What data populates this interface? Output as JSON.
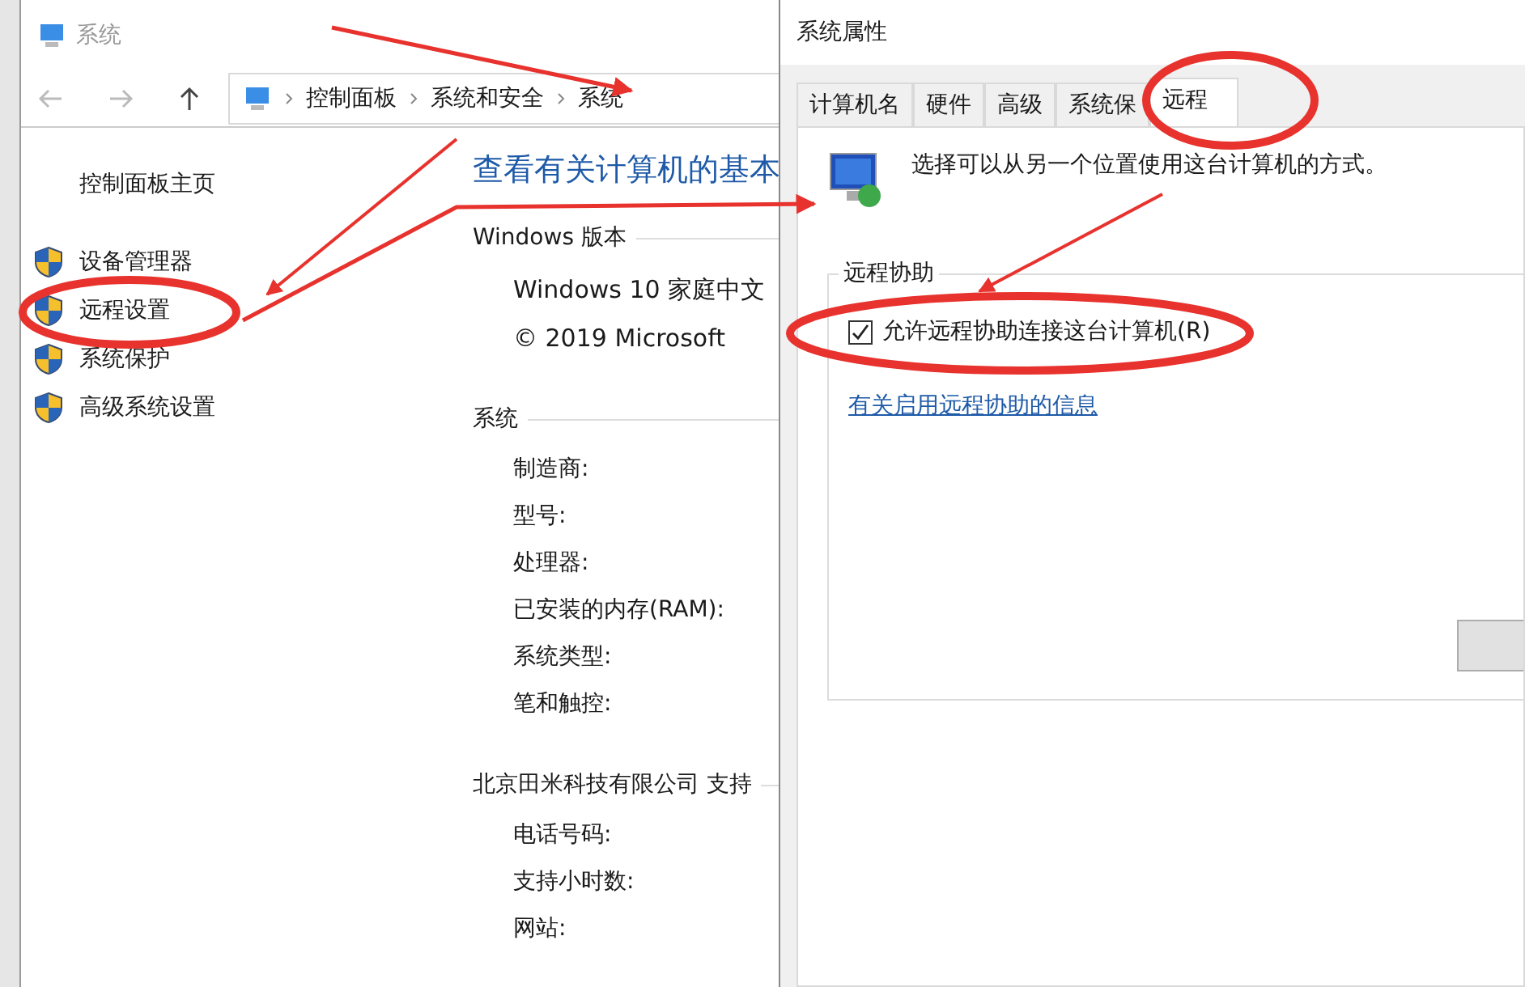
{
  "system_window": {
    "title": "系统",
    "breadcrumb": [
      "控制面板",
      "系统和安全",
      "系统"
    ],
    "sidebar": {
      "home": "控制面板主页",
      "links": [
        "设备管理器",
        "远程设置",
        "系统保护",
        "高级系统设置"
      ]
    },
    "heading": "查看有关计算机的基本",
    "sections": [
      {
        "title": "Windows 版本",
        "rows": [
          "Windows 10 家庭中文",
          "© 2019 Microsoft"
        ]
      },
      {
        "title": "系统",
        "rows": [
          "制造商:",
          "型号:",
          "处理器:",
          "已安装的内存(RAM):",
          "系统类型:",
          "笔和触控:"
        ]
      },
      {
        "title": "北京田米科技有限公司 支持",
        "rows": [
          "电话号码:",
          "支持小时数:",
          "网站:"
        ]
      }
    ]
  },
  "properties_dialog": {
    "title": "系统属性",
    "tabs": [
      {
        "label": "计算机名",
        "selected": false
      },
      {
        "label": "硬件",
        "selected": false
      },
      {
        "label": "高级",
        "selected": false
      },
      {
        "label": "系统保",
        "selected": false
      },
      {
        "label": "远程",
        "selected": true
      }
    ],
    "description": "选择可以从另一个位置使用这台计算机的方式。",
    "group": {
      "title": "远程协助",
      "checkbox": {
        "label": "允许远程协助连接这台计算机(R)",
        "checked": true
      },
      "link": "有关启用远程协助的信息"
    }
  }
}
